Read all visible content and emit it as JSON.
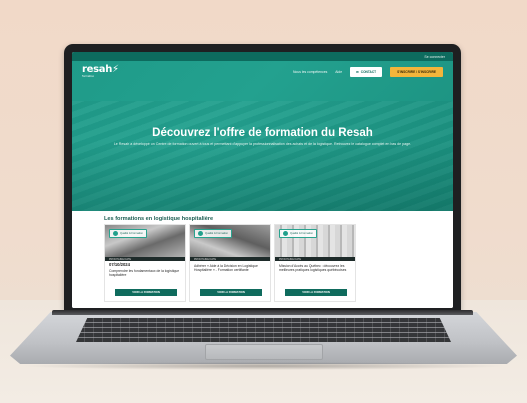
{
  "top_strip": {
    "login_label": "Se connecter"
  },
  "nav": {
    "logo": "resah",
    "logo_sub": "formation",
    "links": [
      "Nous les compétences",
      "Aide"
    ],
    "contact_label": "CONTACT",
    "signup_label": "S'INSCRIRE / S'INSCRIRE"
  },
  "hero": {
    "title": "Découvrez l'offre de formation du Resah",
    "description": "Le Resah a développé un Centre de formation ouvert à tous et permettant d'appuyer la professionnalisation des achats et de la logistique. Retrouvez le catalogue complet en bas de page."
  },
  "section": {
    "title": "Les formations en logistique hospitalière"
  },
  "cards": [
    {
      "tag": "Qualité & Formation",
      "meta": "PROCHAINE DATE",
      "date": "07/10/2024",
      "text": "Comprendre les fondamentaux de la logistique hospitalière",
      "button": "VOIR LA FORMATION"
    },
    {
      "tag": "Qualité & Formation",
      "meta": "PROCHAINE DATE",
      "date": "",
      "text": "Adhérer « Aide à la Décision en Logistique Hospitalière » - Formation certifiante",
      "button": "VOIR LA FORMATION"
    },
    {
      "tag": "Qualité & Formation",
      "meta": "PROCHAINE DATE",
      "date": "",
      "text": "Mission d'Accès au Québec : découvrez les meilleures pratiques logistiques québécoises",
      "button": "VOIR LA FORMATION"
    }
  ],
  "colors": {
    "teal": "#0d6b5e",
    "hero": "#1f9b89",
    "accent": "#f3b53b"
  }
}
